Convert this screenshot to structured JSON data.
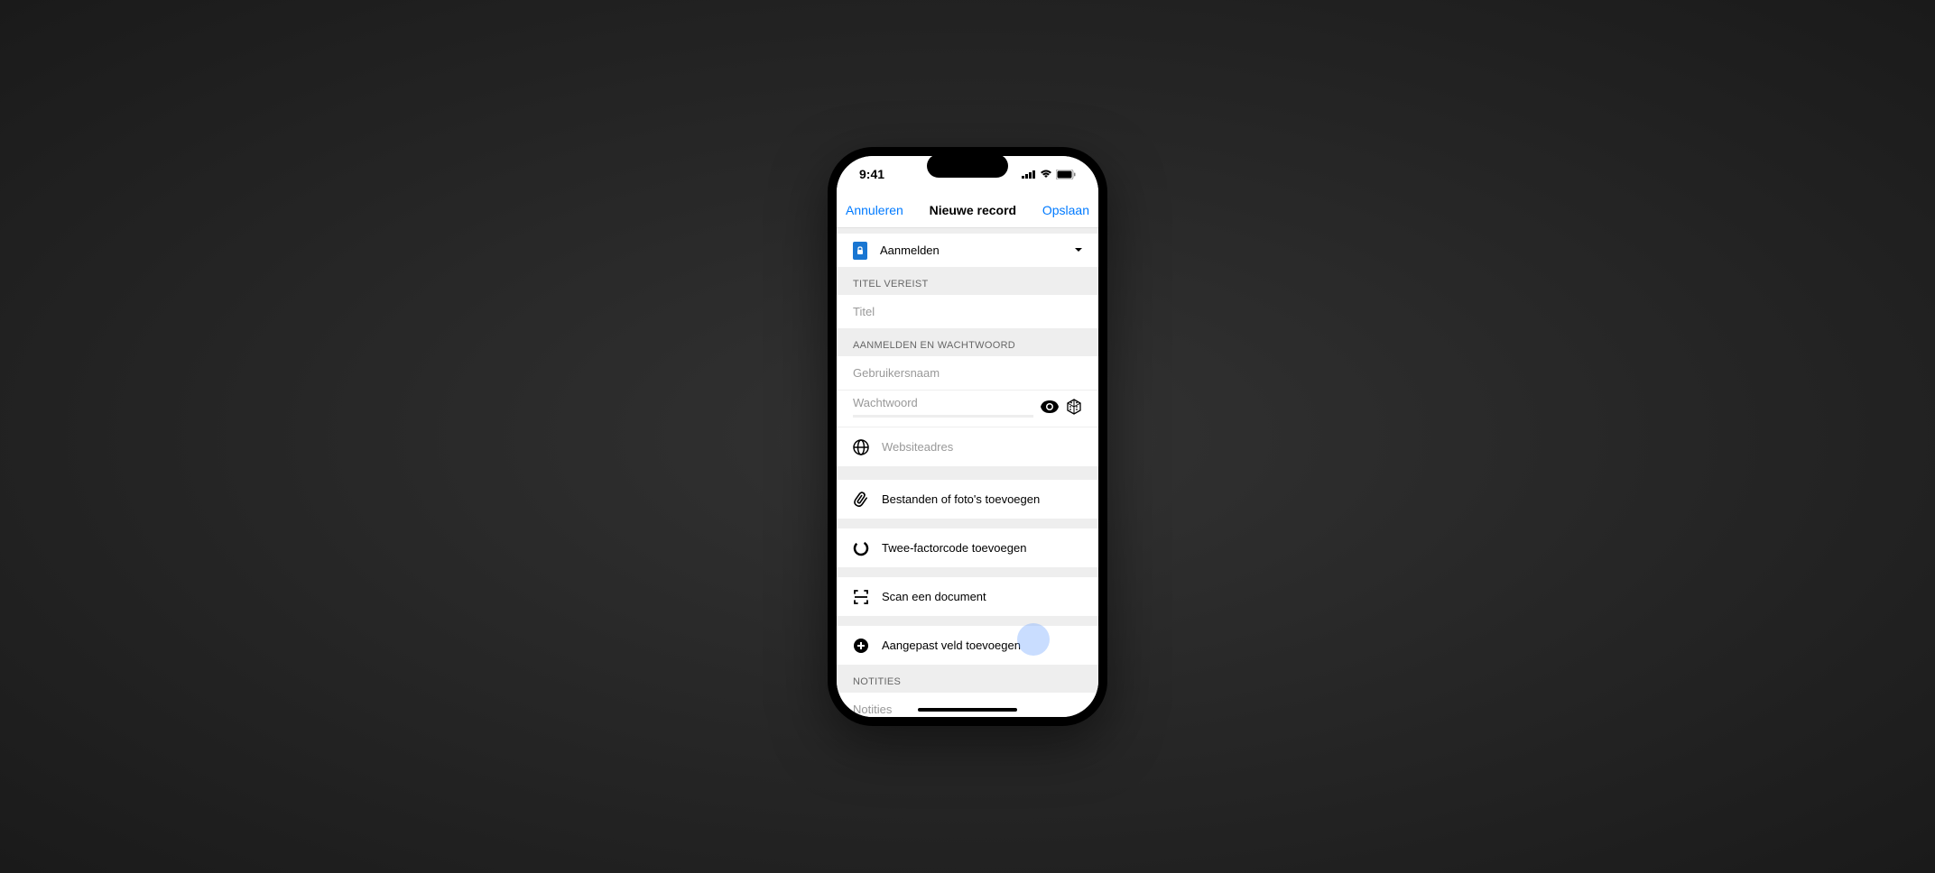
{
  "status": {
    "time": "9:41"
  },
  "nav": {
    "cancel": "Annuleren",
    "title": "Nieuwe record",
    "save": "Opslaan"
  },
  "type": {
    "label": "Aanmelden"
  },
  "sections": {
    "title_header": "TITEL VEREIST",
    "title_placeholder": "Titel",
    "login_header": "AANMELDEN EN WACHTWOORD",
    "username_placeholder": "Gebruikersnaam",
    "password_placeholder": "Wachtwoord",
    "website_placeholder": "Websiteadres",
    "notes_header": "NOTITIES",
    "notes_placeholder": "Notities"
  },
  "actions": {
    "attach": "Bestanden of foto's toevoegen",
    "twofactor": "Twee-factorcode toevoegen",
    "scan": "Scan een document",
    "custom_field": "Aangepast veld toevoegen"
  }
}
